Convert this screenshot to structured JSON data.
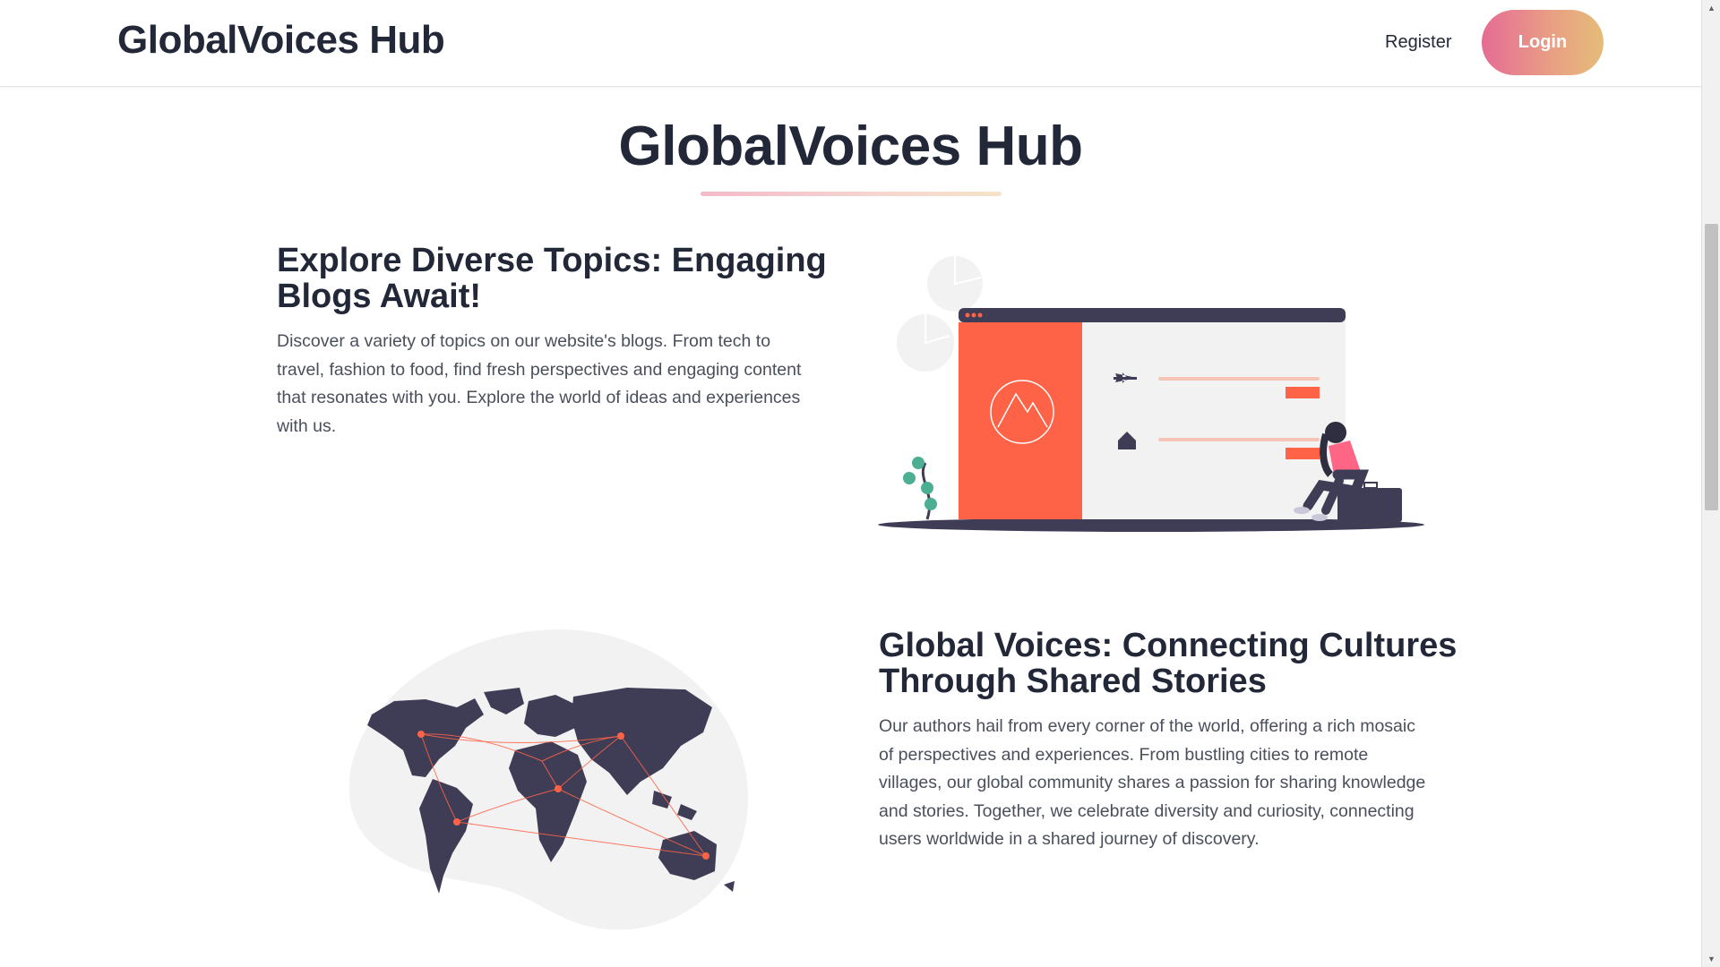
{
  "header": {
    "brand": "GlobalVoices Hub",
    "register_label": "Register",
    "login_label": "Login"
  },
  "main": {
    "title": "GlobalVoices Hub"
  },
  "sections": [
    {
      "heading": "Explore Diverse Topics: Engaging Blogs Await!",
      "text": "Discover a variety of topics on our website's blogs. From tech to travel, fashion to food, find fresh perspectives and engaging content that resonates with you. Explore the world of ideas and experiences with us.",
      "illustration_icon": "travel-booking-illustration"
    },
    {
      "heading": "Global Voices: Connecting Cultures Through Shared Stories",
      "text": "Our authors hail from every corner of the world, offering a rich mosaic of perspectives and experiences. From bustling cities to remote villages, our global community shares a passion for sharing knowledge and stories. Together, we celebrate diversity and curiosity, connecting users worldwide in a shared journey of discovery.",
      "illustration_icon": "world-map-illustration"
    }
  ],
  "colors": {
    "dark_navy": "#3f3d56",
    "accent_orange": "#ff6347",
    "accent_pink": "#e56c95",
    "accent_gold": "#e5bc78",
    "light_gray": "#f2f2f2",
    "plant_green": "#4caf93"
  }
}
